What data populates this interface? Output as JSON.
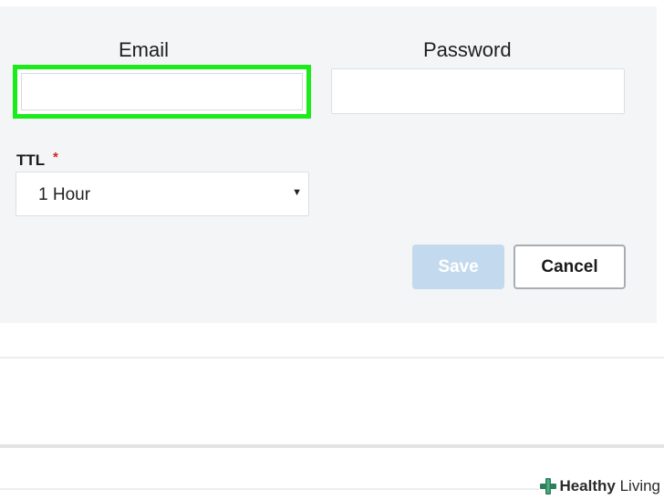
{
  "form": {
    "email_label": "Email",
    "email_value": "",
    "password_label": "Password",
    "password_value": "",
    "ttl_label": "TTL",
    "ttl_required_marker": "*",
    "ttl_selected": "1 Hour",
    "save_label": "Save",
    "cancel_label": "Cancel"
  },
  "watermark": {
    "brand_bold": "Healthy",
    "brand_light": " Living"
  },
  "colors": {
    "highlight": "#1bea1b",
    "save_disabled": "#c3d9ee",
    "required": "#d0262a",
    "panel": "#f4f5f6"
  },
  "icons": {
    "select_arrow": "caret-down-icon",
    "watermark": "medical-cross-icon"
  }
}
